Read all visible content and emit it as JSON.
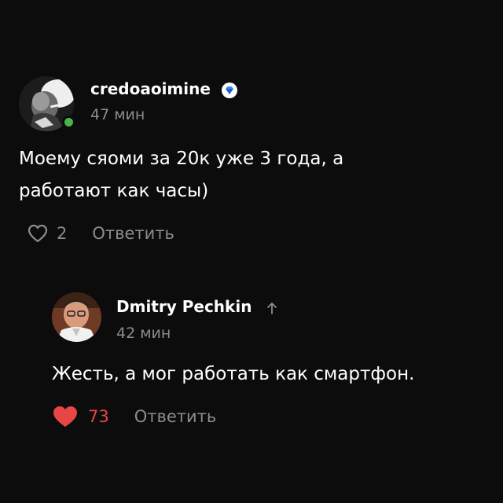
{
  "comment": {
    "author": "credoaoimine",
    "time": "47 мин",
    "text": "Моему сяоми за 20к уже 3 года, а работают как часы)",
    "likes": "2",
    "reply_label": "Ответить",
    "online": true,
    "verified_icon": "diamond-badge-icon",
    "like_icon": "heart-outline-icon"
  },
  "reply": {
    "author": "Dmitry Pechkin",
    "time": "42 мин",
    "text": "Жесть, а мог работать как смартфон.",
    "likes": "73",
    "reply_label": "Ответить",
    "liked": true,
    "author_icon": "arrow-up-icon",
    "like_icon": "heart-filled-icon"
  },
  "colors": {
    "background": "#0c0c0d",
    "text": "#ffffff",
    "muted": "#8c8c90",
    "like_active": "#e64646",
    "online": "#4bb34b",
    "badge": "#3f8ae0"
  }
}
